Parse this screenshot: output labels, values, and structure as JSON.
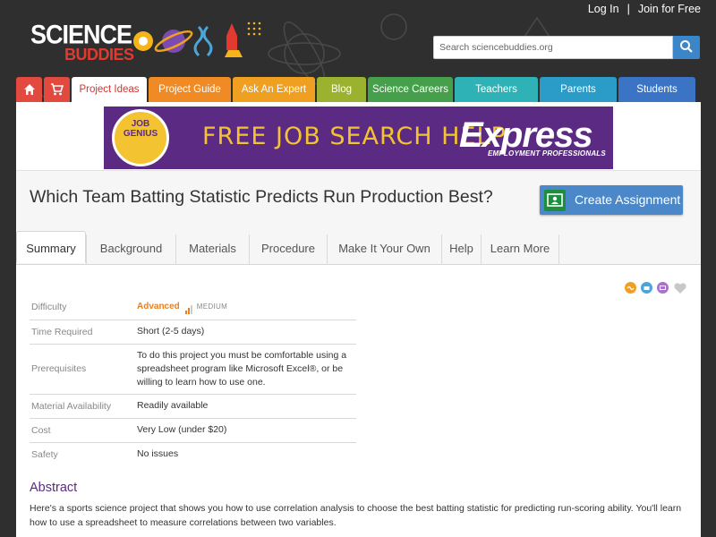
{
  "top_links": {
    "login": "Log In",
    "separator": "|",
    "join": "Join for Free"
  },
  "logo": {
    "line1": "SCIENCE",
    "line2": "BUDDIES"
  },
  "search": {
    "placeholder": "Search sciencebuddies.org",
    "icon": "search-icon"
  },
  "nav": {
    "home_icon": "home-icon",
    "cart_icon": "cart-icon",
    "items": [
      {
        "label": "Project Ideas",
        "color": "#ffffff",
        "text_color": "#d9322f"
      },
      {
        "label": "Project Guide",
        "color": "#f08a24"
      },
      {
        "label": "Ask An Expert",
        "color": "#f0a021"
      },
      {
        "label": "Blog",
        "color": "#9bb230"
      },
      {
        "label": "Science Careers",
        "color": "#46a04b"
      },
      {
        "label": "Teachers",
        "color": "#2fb2b6"
      },
      {
        "label": "Parents",
        "color": "#2b9bc7"
      },
      {
        "label": "Students",
        "color": "#3b74c4"
      }
    ]
  },
  "ad": {
    "badge": "JOB GENIUS",
    "headline": "FREE JOB SEARCH HELP",
    "brand": "Express",
    "brand_sub": "EMPLOYMENT PROFESSIONALS"
  },
  "page": {
    "title": "Which Team Batting Statistic Predicts Run Production Best?",
    "create_button": "Create Assignment"
  },
  "tabs": [
    {
      "label": "Summary",
      "active": true
    },
    {
      "label": "Background"
    },
    {
      "label": "Materials"
    },
    {
      "label": "Procedure"
    },
    {
      "label": "Make It Your Own"
    },
    {
      "label": "Help"
    },
    {
      "label": "Learn More"
    }
  ],
  "share_icons": [
    "google-classroom-icon",
    "print-icon",
    "email-icon",
    "favorite-heart-icon"
  ],
  "facts": {
    "difficulty_label": "Difficulty",
    "difficulty_value": "Advanced",
    "difficulty_level": "MEDIUM",
    "time_label": "Time Required",
    "time_value": "Short (2-5 days)",
    "prereq_label": "Prerequisites",
    "prereq_value": "To do this project you must be comfortable using a spreadsheet program like Microsoft Excel®, or be willing to learn how to use one.",
    "material_label": "Material Availability",
    "material_value": "Readily available",
    "cost_label": "Cost",
    "cost_value": "Very Low (under $20)",
    "safety_label": "Safety",
    "safety_value": "No issues"
  },
  "abstract": {
    "heading": "Abstract",
    "text": "Here's a sports science project that shows you how to use correlation analysis to choose the best batting statistic for predicting run-scoring ability. You'll learn how to use a spreadsheet to measure correlations between two variables."
  },
  "colors": {
    "panel_bg": "#ffffff",
    "page_bg": "#2f2f2f",
    "accent_purple": "#5b2b83",
    "difficulty_orange": "#e77f24",
    "button_blue": "#4a88c9"
  }
}
